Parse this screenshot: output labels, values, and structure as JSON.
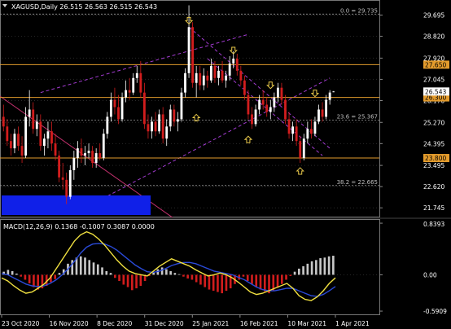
{
  "header": {
    "symbol_line": "XAGUSD,Daily  26.515 26.563 26.515 26.543"
  },
  "colors": {
    "background": "#000000",
    "bull_candle": "#ffffff",
    "bear_candle": "#d21d1d",
    "horizontal_level": "#e39b2c",
    "fib_line": "#9a9a9a",
    "channel_line": "#a23bd0",
    "channel_line_2": "#c0306c",
    "blue_box": "#1020e8",
    "arrow": "#e8c84a",
    "macd_hist_pos": "#c8c8c8",
    "macd_hist_neg": "#d21d1d",
    "macd_main": "#f0e040",
    "macd_signal": "#2a4ad8",
    "axis_text": "#ffffff"
  },
  "chart_data": [
    {
      "type": "candlestick",
      "symbol": "XAGUSD",
      "timeframe": "Daily",
      "last_bar": {
        "open": 26.515,
        "high": 26.563,
        "low": 26.515,
        "close": 26.543
      },
      "y_ticks": [
        "29.695",
        "28.820",
        "27.920",
        "27.045",
        "26.170",
        "25.270",
        "24.395",
        "23.495",
        "22.620",
        "21.745"
      ],
      "ylim": [
        21.45,
        30.25
      ],
      "x_ticks": [
        "23 Oct 2020",
        "16 Nov 2020",
        "8 Dec 2020",
        "31 Dec 2020",
        "25 Jan 2021",
        "16 Feb 2021",
        "10 Mar 2021",
        "1 Apr 2021"
      ],
      "levels": [
        {
          "price": 27.65,
          "label": "27.650",
          "style": "solid",
          "tag": "orange"
        },
        {
          "price": 26.3,
          "label": "26.300",
          "style": "solid",
          "tag": "orange"
        },
        {
          "price": 23.8,
          "label": "23.800",
          "style": "solid",
          "tag": "orange"
        },
        {
          "price": 26.543,
          "label": "26.543",
          "style": "none",
          "tag": "white"
        }
      ],
      "fib_levels": [
        {
          "label": "0.0 = 29.735",
          "price": 29.735
        },
        {
          "label": "23.6 = 25.367",
          "price": 25.367
        },
        {
          "label": "38.2 = 22.665",
          "price": 22.665
        }
      ],
      "candles": [
        [
          25.5,
          26.0,
          24.9,
          25.1
        ],
        [
          25.1,
          25.4,
          24.3,
          24.5
        ],
        [
          24.5,
          24.8,
          23.9,
          24.2
        ],
        [
          24.2,
          25.0,
          24.0,
          24.8
        ],
        [
          24.8,
          25.1,
          24.1,
          24.3
        ],
        [
          24.3,
          24.7,
          23.6,
          23.9
        ],
        [
          23.9,
          25.9,
          23.8,
          25.5
        ],
        [
          25.5,
          26.6,
          25.1,
          25.8
        ],
        [
          25.8,
          26.1,
          24.8,
          25.0
        ],
        [
          25.0,
          25.6,
          24.7,
          25.3
        ],
        [
          25.3,
          25.6,
          24.1,
          24.3
        ],
        [
          24.3,
          24.8,
          23.9,
          24.6
        ],
        [
          24.6,
          25.3,
          24.2,
          24.9
        ],
        [
          24.9,
          25.3,
          24.1,
          24.4
        ],
        [
          24.4,
          24.8,
          23.7,
          23.9
        ],
        [
          23.9,
          24.1,
          22.8,
          23.0
        ],
        [
          23.0,
          23.6,
          22.5,
          22.9
        ],
        [
          22.9,
          23.2,
          21.9,
          22.2
        ],
        [
          22.2,
          23.5,
          22.1,
          23.3
        ],
        [
          23.3,
          24.1,
          22.9,
          23.8
        ],
        [
          23.8,
          24.5,
          23.4,
          24.2
        ],
        [
          24.2,
          24.6,
          23.6,
          23.9
        ],
        [
          23.9,
          24.3,
          23.5,
          24.0
        ],
        [
          24.0,
          24.4,
          23.8,
          24.1
        ],
        [
          24.1,
          24.3,
          23.4,
          23.6
        ],
        [
          23.6,
          24.2,
          23.4,
          24.0
        ],
        [
          24.0,
          24.4,
          23.7,
          23.8
        ],
        [
          23.8,
          25.0,
          23.7,
          24.8
        ],
        [
          24.8,
          25.7,
          24.6,
          25.5
        ],
        [
          25.5,
          26.5,
          25.3,
          26.2
        ],
        [
          26.2,
          26.7,
          25.6,
          25.9
        ],
        [
          25.9,
          26.4,
          25.2,
          25.4
        ],
        [
          25.4,
          26.5,
          25.3,
          26.3
        ],
        [
          26.3,
          27.0,
          26.1,
          26.6
        ],
        [
          26.6,
          27.1,
          26.2,
          26.5
        ],
        [
          26.5,
          27.3,
          26.4,
          27.1
        ],
        [
          27.1,
          27.6,
          26.9,
          27.3
        ],
        [
          27.3,
          27.8,
          26.3,
          26.5
        ],
        [
          26.5,
          26.9,
          25.0,
          25.2
        ],
        [
          25.2,
          25.6,
          24.6,
          24.9
        ],
        [
          24.9,
          25.5,
          24.6,
          25.3
        ],
        [
          25.3,
          25.7,
          24.7,
          24.9
        ],
        [
          24.9,
          25.8,
          24.8,
          25.6
        ],
        [
          25.6,
          25.9,
          24.4,
          24.6
        ],
        [
          24.6,
          25.4,
          24.3,
          25.1
        ],
        [
          25.1,
          26.0,
          24.9,
          25.8
        ],
        [
          25.8,
          26.0,
          25.1,
          25.3
        ],
        [
          25.3,
          25.7,
          24.9,
          25.4
        ],
        [
          25.4,
          26.7,
          25.3,
          26.5
        ],
        [
          26.5,
          27.5,
          26.3,
          27.3
        ],
        [
          27.3,
          30.1,
          27.1,
          29.2
        ],
        [
          29.2,
          29.4,
          26.7,
          26.9
        ],
        [
          26.9,
          27.6,
          26.3,
          27.3
        ],
        [
          27.3,
          27.6,
          26.6,
          26.8
        ],
        [
          26.8,
          27.5,
          26.6,
          27.2
        ],
        [
          27.2,
          27.4,
          26.7,
          27.0
        ],
        [
          27.0,
          27.9,
          26.9,
          27.6
        ],
        [
          27.6,
          27.8,
          26.9,
          27.1
        ],
        [
          27.1,
          27.6,
          26.8,
          27.4
        ],
        [
          27.4,
          27.8,
          26.9,
          27.0
        ],
        [
          27.0,
          27.4,
          26.7,
          27.2
        ],
        [
          27.2,
          28.0,
          27.0,
          27.7
        ],
        [
          27.7,
          28.2,
          27.5,
          27.9
        ],
        [
          27.9,
          28.1,
          27.2,
          27.4
        ],
        [
          27.4,
          27.6,
          26.8,
          27.0
        ],
        [
          27.0,
          27.2,
          26.2,
          26.4
        ],
        [
          26.4,
          26.6,
          25.4,
          25.6
        ],
        [
          25.6,
          25.9,
          25.0,
          25.2
        ],
        [
          25.2,
          26.0,
          25.1,
          25.8
        ],
        [
          25.8,
          26.4,
          25.6,
          26.2
        ],
        [
          26.2,
          26.6,
          25.8,
          26.0
        ],
        [
          26.0,
          26.3,
          25.5,
          25.7
        ],
        [
          25.7,
          26.2,
          25.4,
          25.9
        ],
        [
          25.9,
          26.5,
          25.7,
          26.3
        ],
        [
          26.3,
          26.9,
          26.1,
          26.7
        ],
        [
          26.7,
          26.9,
          26.0,
          26.2
        ],
        [
          26.2,
          26.4,
          25.2,
          25.4
        ],
        [
          25.4,
          25.7,
          24.6,
          24.8
        ],
        [
          24.8,
          25.3,
          24.5,
          25.1
        ],
        [
          25.1,
          25.4,
          24.3,
          24.5
        ],
        [
          24.5,
          24.7,
          23.6,
          23.8
        ],
        [
          23.8,
          24.8,
          23.7,
          24.6
        ],
        [
          24.6,
          25.3,
          24.4,
          25.0
        ],
        [
          25.0,
          25.4,
          24.6,
          24.8
        ],
        [
          24.8,
          25.5,
          24.7,
          25.3
        ],
        [
          25.3,
          26.0,
          25.2,
          25.8
        ],
        [
          25.8,
          26.1,
          25.3,
          25.5
        ],
        [
          25.5,
          26.4,
          25.4,
          26.2
        ],
        [
          26.2,
          26.6,
          26.0,
          26.5
        ],
        [
          26.515,
          26.563,
          26.515,
          26.543
        ]
      ],
      "annotations": {
        "arrow_up_count": 3,
        "arrow_down_count": 4
      }
    },
    {
      "type": "histogram-line",
      "title": "MACD(12,26,9) 0.1368 -0.1007 0.3087 0.0000",
      "indicator": "MACD",
      "params": [
        12,
        26,
        9
      ],
      "printed_values": [
        0.1368,
        -0.1007,
        0.3087,
        0.0
      ],
      "y_ticks": [
        "0.8393",
        "0.00",
        "-0.5909"
      ],
      "ylim": [
        -0.63,
        0.88
      ],
      "hist": [
        0.05,
        0.08,
        0.06,
        0.02,
        -0.03,
        -0.08,
        -0.14,
        -0.2,
        -0.24,
        -0.22,
        -0.18,
        -0.12,
        -0.07,
        0.03,
        0.09,
        0.18,
        0.24,
        0.28,
        0.3,
        0.28,
        0.24,
        0.2,
        0.17,
        0.12,
        0.06,
        0.03,
        -0.05,
        -0.1,
        -0.16,
        -0.2,
        -0.25,
        -0.22,
        -0.18,
        -0.1,
        -0.02,
        0.05,
        0.09,
        0.12,
        0.09,
        0.06,
        0.03,
        0.01,
        -0.03,
        -0.06,
        -0.08,
        -0.12,
        -0.16,
        -0.2,
        -0.24,
        -0.26,
        -0.28,
        -0.3,
        -0.26,
        -0.22,
        -0.15,
        -0.08,
        -0.03,
        -0.1,
        -0.15,
        -0.2,
        -0.24,
        -0.27,
        -0.3,
        -0.26,
        -0.21,
        -0.15,
        -0.08,
        -0.02,
        0.05,
        0.1,
        0.14,
        0.18,
        0.22,
        0.24,
        0.27,
        0.28,
        0.3,
        0.31
      ],
      "macd_line": [
        -0.05,
        -0.1,
        -0.18,
        -0.25,
        -0.3,
        -0.28,
        -0.22,
        -0.15,
        -0.05,
        0.1,
        0.25,
        0.4,
        0.55,
        0.65,
        0.7,
        0.66,
        0.58,
        0.48,
        0.36,
        0.24,
        0.14,
        0.06,
        0.02,
        0.0,
        -0.02,
        0.06,
        0.14,
        0.2,
        0.26,
        0.22,
        0.18,
        0.14,
        0.08,
        0.03,
        -0.02,
        0.0,
        0.03,
        0.0,
        -0.05,
        -0.12,
        -0.2,
        -0.28,
        -0.32,
        -0.3,
        -0.26,
        -0.22,
        -0.18,
        -0.14,
        -0.22,
        -0.34,
        -0.4,
        -0.42,
        -0.36,
        -0.26,
        -0.14,
        -0.05
      ],
      "signal_line": [
        0.02,
        0.0,
        -0.05,
        -0.1,
        -0.15,
        -0.18,
        -0.19,
        -0.18,
        -0.14,
        -0.08,
        0.0,
        0.1,
        0.22,
        0.35,
        0.45,
        0.5,
        0.51,
        0.5,
        0.46,
        0.4,
        0.32,
        0.24,
        0.16,
        0.1,
        0.05,
        0.04,
        0.06,
        0.1,
        0.15,
        0.18,
        0.2,
        0.2,
        0.18,
        0.14,
        0.1,
        0.06,
        0.04,
        0.02,
        0.0,
        -0.04,
        -0.08,
        -0.14,
        -0.2,
        -0.24,
        -0.26,
        -0.26,
        -0.24,
        -0.22,
        -0.22,
        -0.26,
        -0.3,
        -0.34,
        -0.35,
        -0.32,
        -0.26,
        -0.19
      ]
    }
  ]
}
